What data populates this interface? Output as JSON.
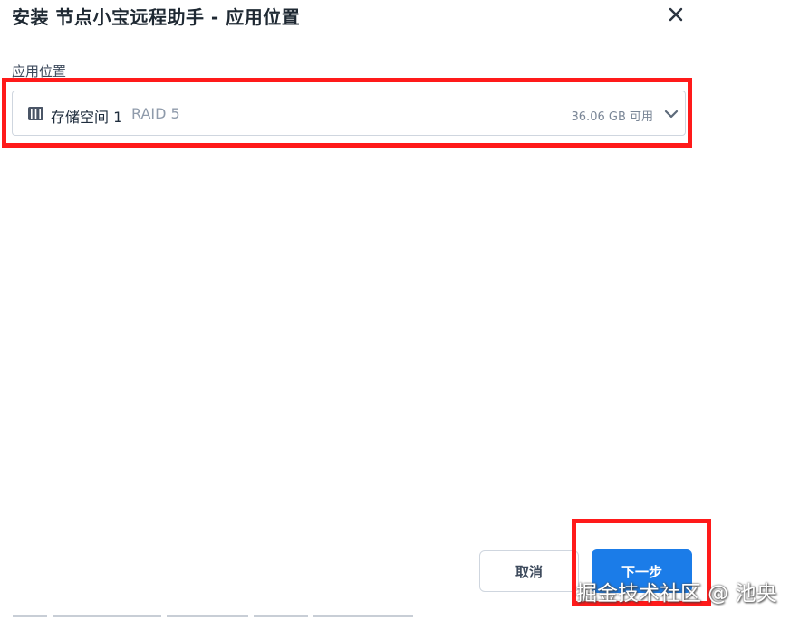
{
  "dialog": {
    "title": "安装 节点小宝远程助手 - 应用位置",
    "close_icon": "close-icon"
  },
  "location": {
    "label": "应用位置",
    "selected": {
      "icon": "storage-volume-icon",
      "name": "存储空间 1",
      "raid": "RAID 5",
      "available": "36.06 GB 可用"
    },
    "dropdown_icon": "chevron-down-icon"
  },
  "actions": {
    "cancel_label": "取消",
    "next_label": "下一步"
  },
  "watermark": "掘金技术社区 @ 池央",
  "colors": {
    "primary": "#1b7ce8",
    "highlight": "#ff1a1a",
    "border": "#cfd6df"
  }
}
